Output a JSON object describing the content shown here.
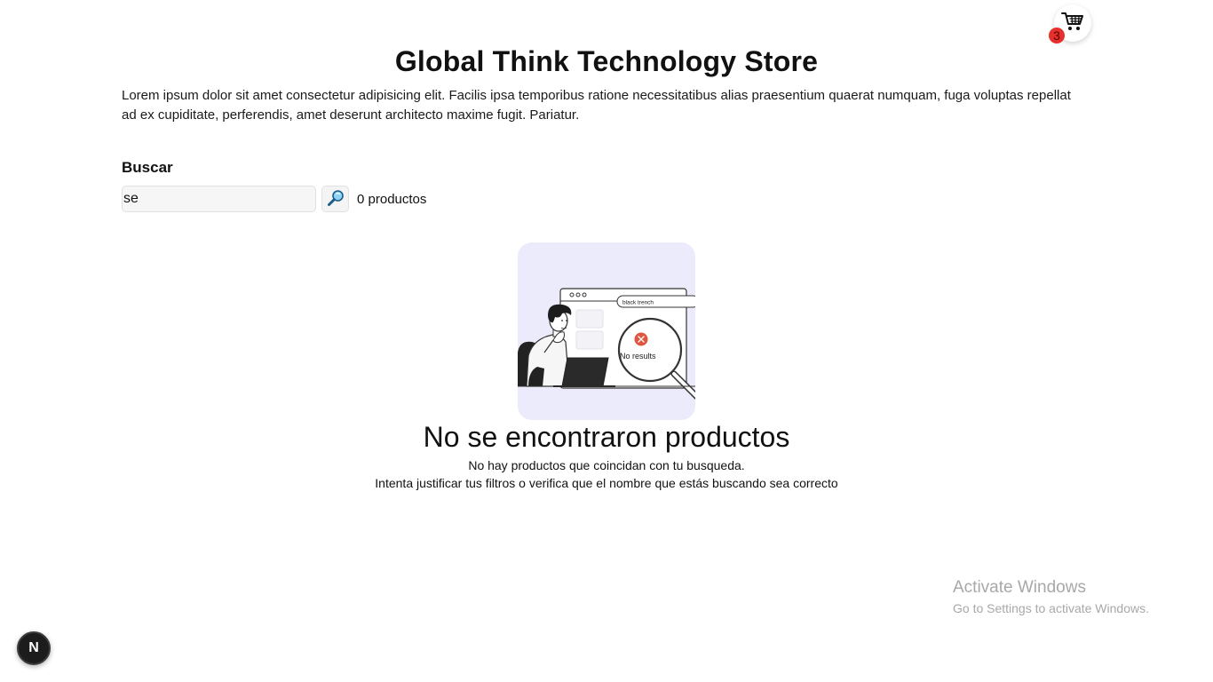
{
  "header": {
    "title": "Global Think Technology Store",
    "description": "Lorem ipsum dolor sit amet consectetur adipisicing elit. Facilis ipsa temporibus ratione necessitatibus alias praesentium quaerat numquam, fuga voluptas repellat ad ex cupiditate, perferendis, amet deserunt architecto maxime fugit. Pariatur."
  },
  "cart": {
    "count": "3",
    "icon": "shopping-cart-icon",
    "badge_color": "#e5302b"
  },
  "search": {
    "label": "Buscar",
    "value": "se",
    "button_icon": "magnifier-icon",
    "result_count": "0 productos"
  },
  "illustration": {
    "search_text": "black trench",
    "no_results_text": "No results",
    "background_color": "#ebebfb"
  },
  "empty_state": {
    "title": "No se encontraron productos",
    "line1": "No hay productos que coincidan con tu busqueda.",
    "line2": "Intenta justificar tus filtros o verifica que el nombre que estás buscando sea correcto"
  },
  "watermark": {
    "title": "Activate Windows",
    "subtitle": "Go to Settings to activate Windows."
  },
  "dev_badge": {
    "label": "N"
  }
}
